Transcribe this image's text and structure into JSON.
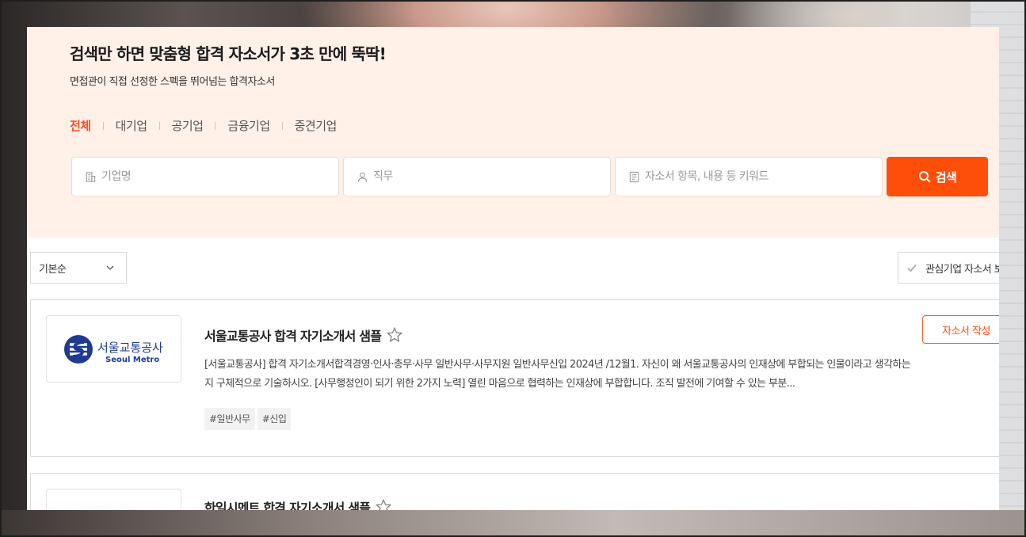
{
  "hero": {
    "title": "검색만 하면 맞춤형 합격 자소서가 3초 만에 뚝딱!",
    "subtitle": "면접관이 직접 선정한 스펙을 뛰어넘는 합격자소서"
  },
  "categories": [
    {
      "label": "전체",
      "active": true
    },
    {
      "label": "대기업",
      "active": false
    },
    {
      "label": "공기업",
      "active": false
    },
    {
      "label": "금융기업",
      "active": false
    },
    {
      "label": "중견기업",
      "active": false
    }
  ],
  "search": {
    "company_placeholder": "기업명",
    "job_placeholder": "직무",
    "keyword_placeholder": "자소서 항목, 내용 등 키워드",
    "button_label": "검색"
  },
  "toolbar": {
    "sort_label": "기본순",
    "fav_filter_label": "관심기업 자소서 보기"
  },
  "cards": [
    {
      "logo_text_ko": "서울교통공사",
      "logo_text_en": "Seoul Metro",
      "title": "서울교통공사 합격 자기소개서 샘플",
      "description": "[서울교통공사] 합격 자기소개서합격경영·인사·총무·사무 일반사무·사무지원 일반사무신입 2024년 /12월1. 자신이 왜 서울교통공사의 인재상에 부합되는 인물이라고 생각하는지 구체적으로 기술하시오. [사무행정인이 되기 위한 2가지 노력] 열린 마음으로 협력하는 인재상에 부합합니다. 조직 발전에 기여할 수 있는 부분...",
      "tags": [
        "#일반사무",
        "#신입"
      ],
      "write_button": "자소서 작성"
    },
    {
      "title": "한일시멘트 합격 자기소개서 샘플"
    }
  ],
  "colors": {
    "accent": "#ff4e0a",
    "hero_bg": "#fff0e8",
    "logo_blue": "#1f3a93"
  }
}
